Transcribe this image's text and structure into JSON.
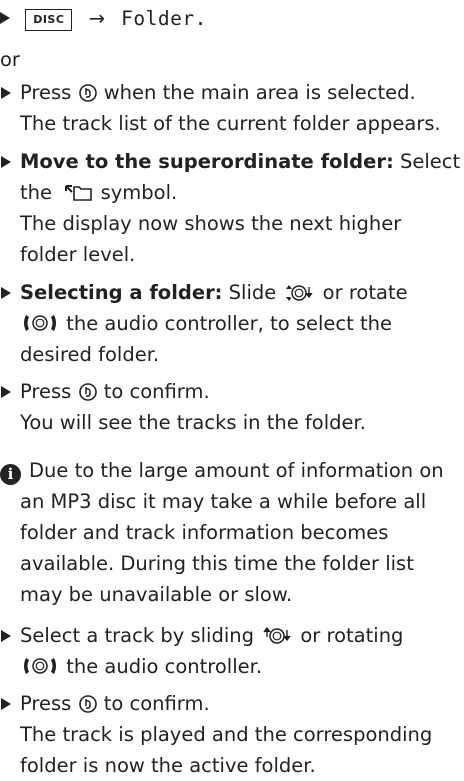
{
  "header_line": {
    "key_label": "DISC",
    "arrow": "→",
    "target": "Folder."
  },
  "or_text": "or",
  "items": [
    {
      "lines": [
        {
          "before": "Press ",
          "after": " when the main area is selected.",
          "icon": "press-controller-icon"
        },
        {
          "text": "The track list of the current folder appears."
        }
      ]
    },
    {
      "bold": "Move to the superordinate folder:",
      "after_bold": " Select",
      "line2_before": "the ",
      "line2_after": " symbol.",
      "line2_icon": "folder-up-icon",
      "cont": [
        "The display now shows the next higher",
        "folder level."
      ]
    },
    {
      "bold": "Selecting a folder:",
      "after_bold": " Slide ",
      "after_icon1": " or rotate",
      "icon1": "slide-controller-icon",
      "icon2": "rotate-controller-icon",
      "line2_after": " the audio controller, to select the",
      "cont": [
        "desired folder."
      ]
    },
    {
      "before": "Press ",
      "after": " to confirm.",
      "icon": "press-controller-icon",
      "cont": [
        "You will see the tracks in the folder."
      ]
    }
  ],
  "info": {
    "icon": "info-icon",
    "lines": [
      "Due to the large amount of information on",
      "an MP3 disc it may take a while before all",
      "folder and track information becomes",
      "available. During this time the folder list",
      "may be unavailable or slow."
    ]
  },
  "items2": [
    {
      "before": "Select a track by sliding ",
      "after": " or rotating",
      "icon1": "slide-controller-icon",
      "icon2": "rotate-controller-icon",
      "line2_after": " the audio controller."
    },
    {
      "before": "Press ",
      "after": " to confirm.",
      "icon": "press-controller-icon",
      "cont": [
        "The track is played and the corresponding",
        "folder is now the active folder."
      ]
    }
  ]
}
